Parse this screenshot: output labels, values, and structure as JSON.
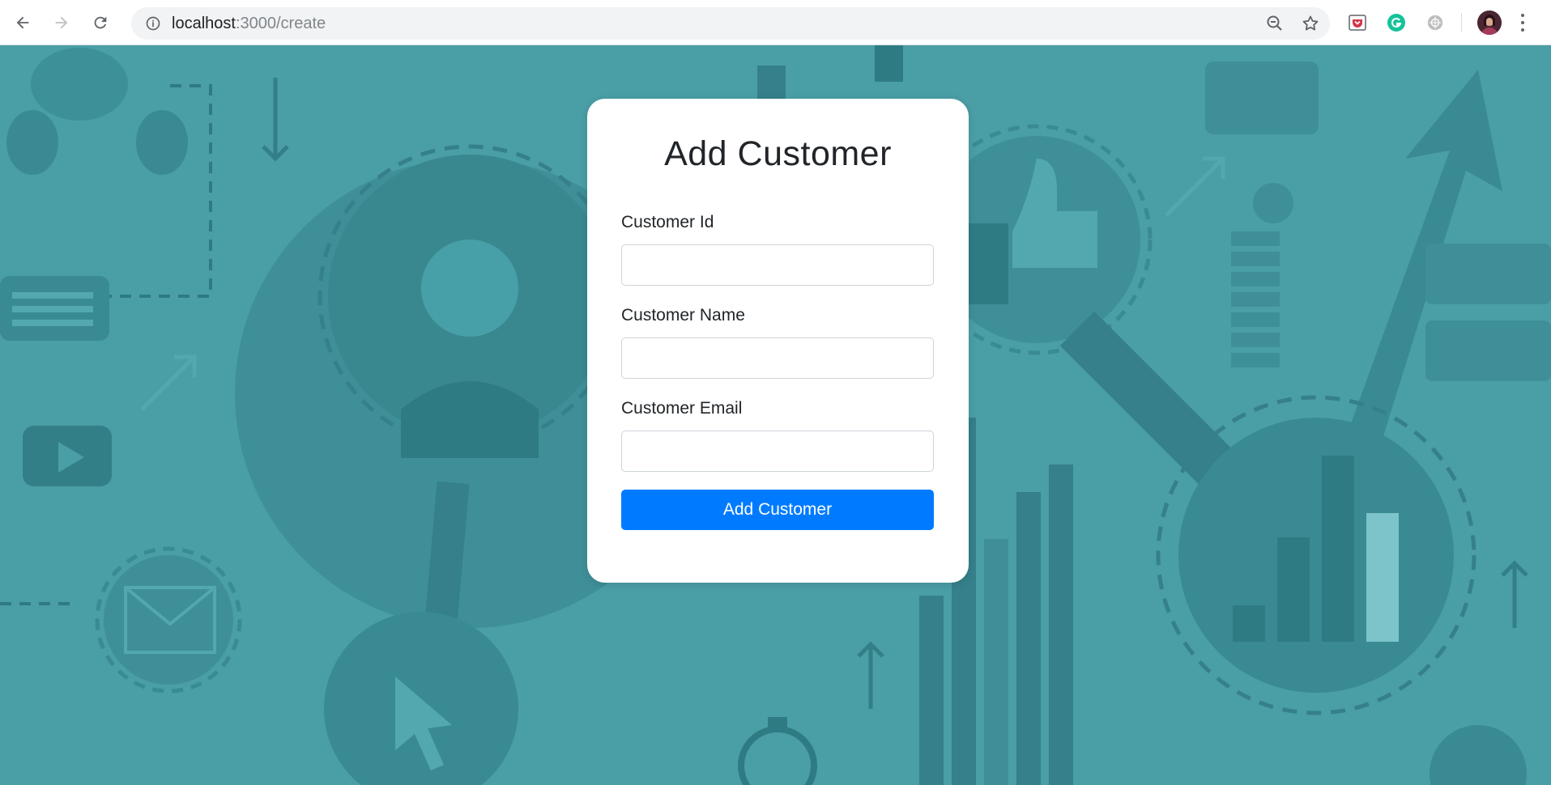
{
  "browser": {
    "url_host": "localhost",
    "url_path": ":3000/create",
    "icons": {
      "back": "arrow-left-icon",
      "forward": "arrow-right-icon",
      "reload": "reload-icon",
      "info": "info-icon",
      "zoom": "zoom-out-icon",
      "bookmark": "star-icon",
      "menu": "more-vert-icon"
    }
  },
  "form": {
    "title": "Add Customer",
    "fields": [
      {
        "label": "Customer Id",
        "value": "",
        "placeholder": ""
      },
      {
        "label": "Customer Name",
        "value": "",
        "placeholder": ""
      },
      {
        "label": "Customer Email",
        "value": "",
        "placeholder": ""
      }
    ],
    "submit_label": "Add Customer"
  },
  "colors": {
    "background": "#4a9ea6",
    "primary_button": "#007bff",
    "card": "#ffffff"
  }
}
